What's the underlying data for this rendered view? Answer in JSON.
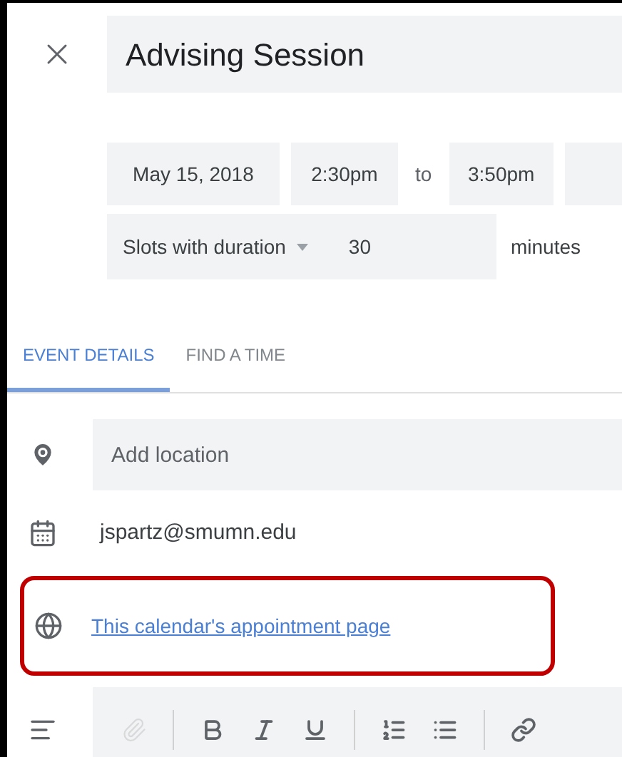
{
  "title": "Advising Session",
  "date": "May 15, 2018",
  "start_time": "2:30pm",
  "separator": "to",
  "end_time": "3:50pm",
  "slots": {
    "mode": "Slots with duration",
    "duration": "30",
    "unit": "minutes"
  },
  "tabs": [
    {
      "label": "EVENT DETAILS",
      "selected": true
    },
    {
      "label": "FIND A TIME",
      "selected": false
    }
  ],
  "location": {
    "placeholder": "Add location"
  },
  "calendar": "jspartz@smumn.edu",
  "appointment_link": {
    "label": "This calendar's appointment page",
    "highlighted": true
  },
  "toolbar_groups": [
    [
      {
        "kind": "attach",
        "disabled": true
      }
    ],
    [
      {
        "kind": "bold",
        "disabled": false
      },
      {
        "kind": "italic",
        "disabled": false
      },
      {
        "kind": "underline",
        "disabled": false
      }
    ],
    [
      {
        "kind": "numbered-list",
        "disabled": false
      },
      {
        "kind": "bulleted-list",
        "disabled": false
      }
    ],
    [
      {
        "kind": "link",
        "disabled": false
      }
    ]
  ]
}
